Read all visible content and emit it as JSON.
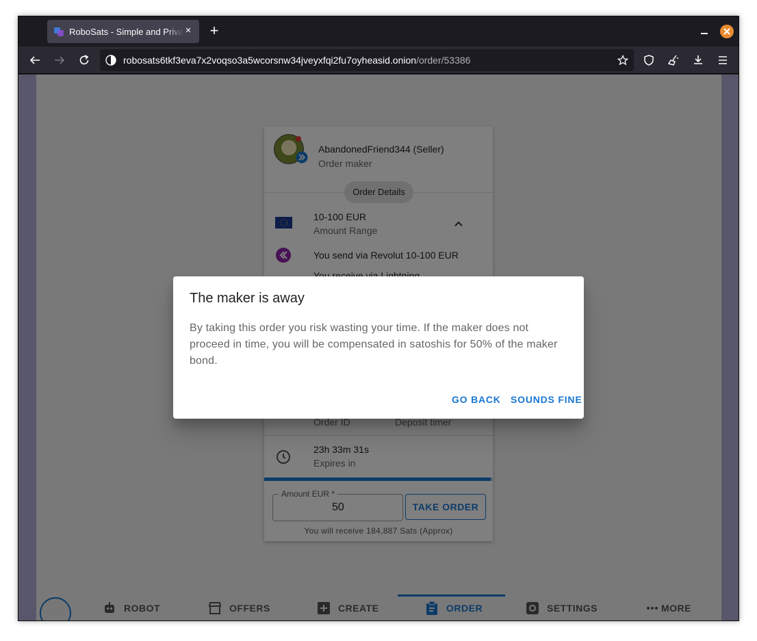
{
  "browser": {
    "tab_title": "RoboSats - Simple and Private Bitcoin Exchange",
    "tab_close": "×",
    "new_tab": "+",
    "url_host": "robosats6tkf3eva7x2voqso3a5wcorsnw34jveyxfqi2fu7oyheasid.onion",
    "url_path": "/order/53386"
  },
  "order": {
    "maker_name": "AbandonedFriend344 (Seller)",
    "maker_role": "Order maker",
    "details_chip": "Order Details",
    "amount_range": "10-100 EUR",
    "amount_range_label": "Amount Range",
    "send_via": "You send via Revolut 10-100 EUR",
    "receive_via": "You receive via Lightning",
    "order_id_label": "Order ID",
    "deposit_timer_label": "Deposit timer",
    "expires_value": "23h 33m 31s",
    "expires_label": "Expires in",
    "progress_fraction": 0.99,
    "amount_label": "Amount EUR *",
    "amount_value": "50",
    "take_button": "TAKE ORDER",
    "receive_note": "You will receive 184,887 Sats (Approx)"
  },
  "bottom_nav": {
    "robot": "ROBOT",
    "offers": "OFFERS",
    "create": "CREATE",
    "order": "ORDER",
    "settings": "SETTINGS",
    "more": "MORE",
    "active": "order"
  },
  "dialog": {
    "title": "The maker is away",
    "body": "By taking this order you risk wasting your time. If the maker does not proceed in time, you will be compensated in satoshis for 50% of the maker bond.",
    "go_back": "GO BACK",
    "sounds_fine": "SOUNDS FINE"
  },
  "colors": {
    "accent": "#1976d2",
    "firefox_close": "#e98a2f"
  }
}
